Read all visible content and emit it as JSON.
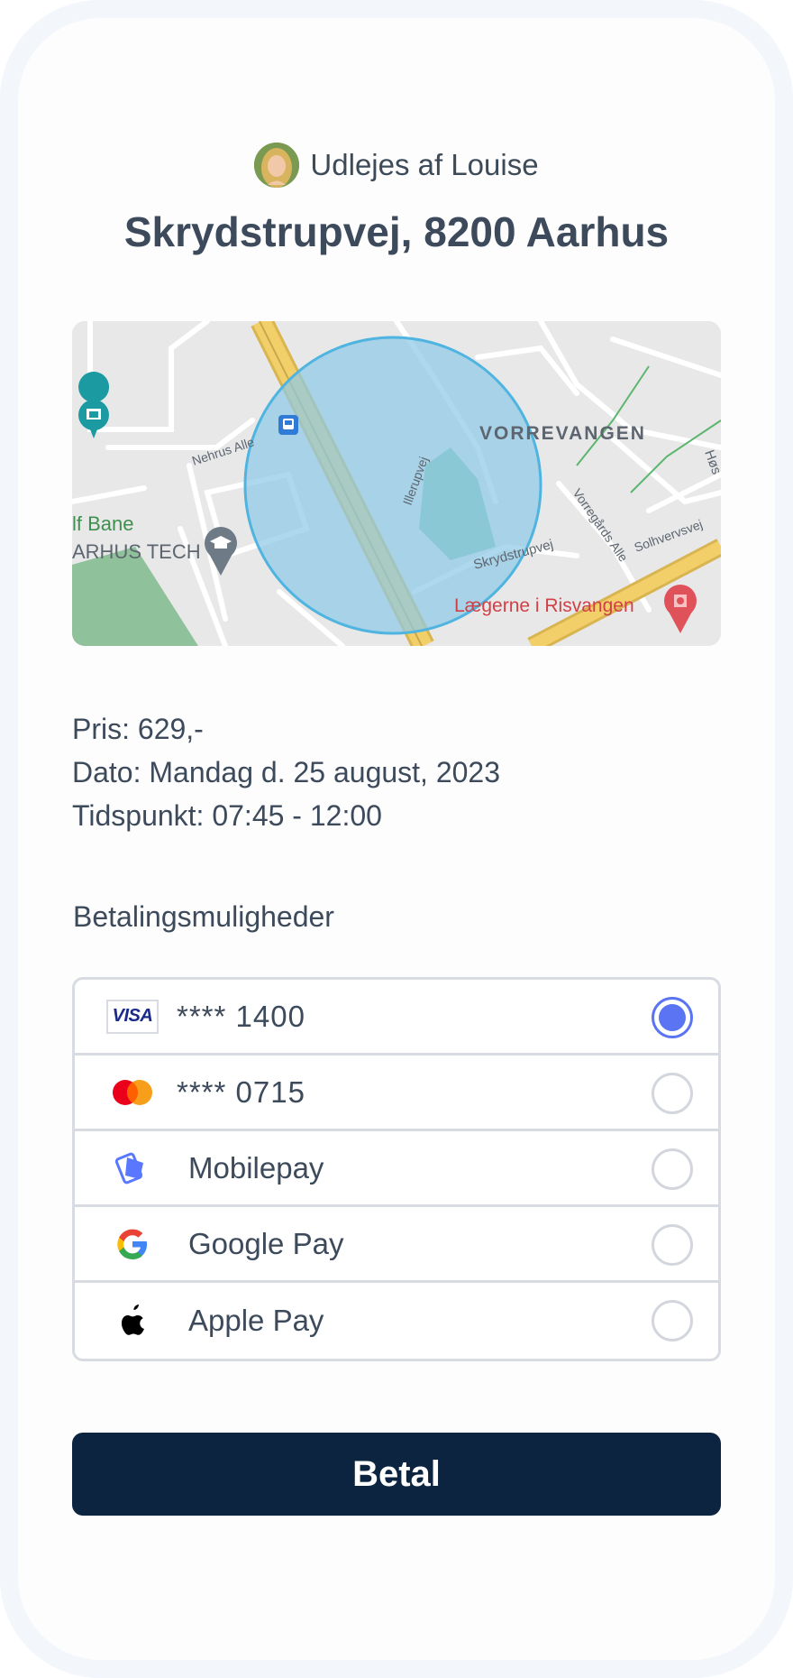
{
  "host": {
    "label": "Udlejes af Louise"
  },
  "listing": {
    "title": "Skrydstrupvej, 8200 Aarhus"
  },
  "map": {
    "labels": {
      "district": "VORREVANGEN",
      "street_nehrus": "Nehrus Alle",
      "street_illerup": "Illerupvej",
      "street_skrydstrup": "Skrydstrupvej",
      "street_vorregaards": "Vorregårds Alle",
      "street_solhverv": "Solhvervsvej",
      "street_hos": "Høs",
      "poi_bane": "lf Bane",
      "poi_tech": "ARHUS TECH",
      "poi_clinic": "Lægerne i Risvangen"
    },
    "colors": {
      "circle_fill": "#8ec9e6",
      "circle_stroke": "#4fb4e0",
      "road": "#f3cf6a",
      "park": "#8fc19a"
    }
  },
  "details": {
    "price": "Pris: 629,-",
    "date": "Dato: Mandag d. 25 august, 2023",
    "time": "Tidspunkt: 07:45 - 12:00"
  },
  "payment": {
    "section_label": "Betalingsmuligheder",
    "options": [
      {
        "icon": "visa-icon",
        "label": "****  1400",
        "selected": true
      },
      {
        "icon": "mastercard-icon",
        "label": "****  0715",
        "selected": false
      },
      {
        "icon": "mobilepay-icon",
        "label": "Mobilepay",
        "selected": false
      },
      {
        "icon": "google-icon",
        "label": "Google Pay",
        "selected": false
      },
      {
        "icon": "apple-icon",
        "label": "Apple Pay",
        "selected": false
      }
    ],
    "visa_badge_text": "VISA",
    "accent_color": "#5b74f4"
  },
  "actions": {
    "pay_label": "Betal",
    "pay_color": "#0c243f"
  }
}
